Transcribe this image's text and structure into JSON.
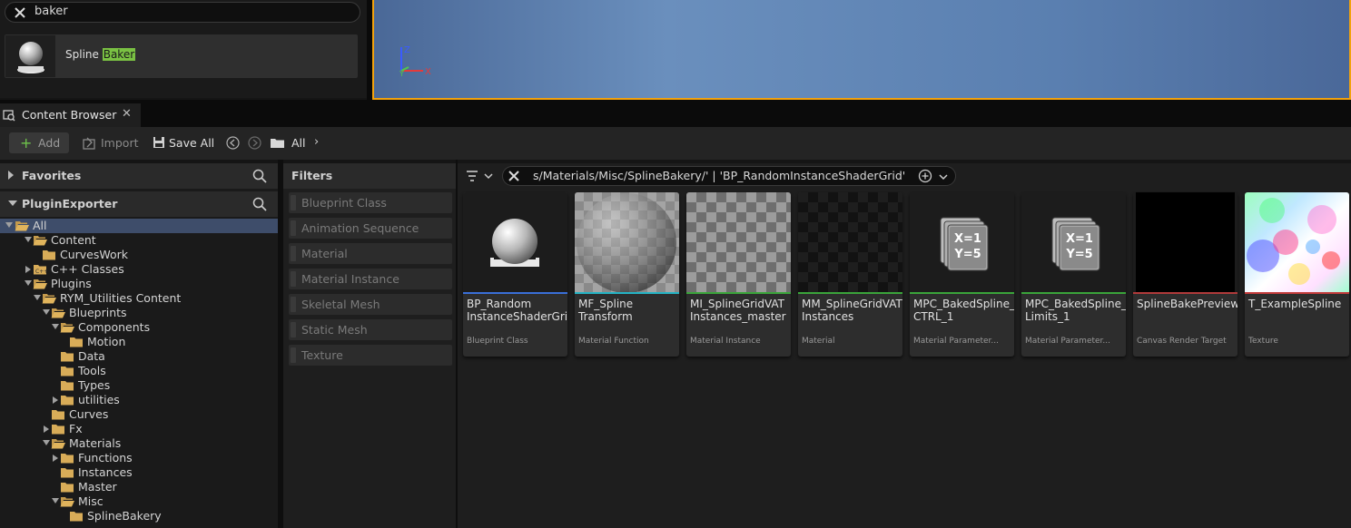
{
  "search": {
    "query": "baker"
  },
  "search_result": {
    "label_prefix": "Spline ",
    "label_highlight": "Baker"
  },
  "viewport": {
    "axis_z": "Z",
    "axis_x": "X",
    "axis_y": "Y"
  },
  "tab": {
    "label": "Content Browser",
    "close": "✕"
  },
  "toolbar": {
    "add_label": "Add",
    "import_label": "Import",
    "save_all_label": "Save All",
    "path_root": "All",
    "path_chevron": "›"
  },
  "left_panel": {
    "favorites_label": "Favorites",
    "plugin_exporter_label": "PluginExporter",
    "tree": [
      {
        "label": "All",
        "depth": 0,
        "expand": "open",
        "selected": true
      },
      {
        "label": "Content",
        "depth": 1,
        "expand": "open"
      },
      {
        "label": "CurvesWork",
        "depth": 2,
        "expand": "none"
      },
      {
        "label": "C++ Classes",
        "depth": 1,
        "expand": "closed",
        "cpp": true
      },
      {
        "label": "Plugins",
        "depth": 1,
        "expand": "open"
      },
      {
        "label": "RYM_Utilities Content",
        "depth": 2,
        "expand": "open"
      },
      {
        "label": "Blueprints",
        "depth": 3,
        "expand": "open"
      },
      {
        "label": "Components",
        "depth": 4,
        "expand": "open"
      },
      {
        "label": "Motion",
        "depth": 5,
        "expand": "none"
      },
      {
        "label": "Data",
        "depth": 4,
        "expand": "none"
      },
      {
        "label": "Tools",
        "depth": 4,
        "expand": "none"
      },
      {
        "label": "Types",
        "depth": 4,
        "expand": "none"
      },
      {
        "label": "utilities",
        "depth": 4,
        "expand": "closed"
      },
      {
        "label": "Curves",
        "depth": 3,
        "expand": "none"
      },
      {
        "label": "Fx",
        "depth": 3,
        "expand": "closed"
      },
      {
        "label": "Materials",
        "depth": 3,
        "expand": "open"
      },
      {
        "label": "Functions",
        "depth": 4,
        "expand": "closed"
      },
      {
        "label": "Instances",
        "depth": 4,
        "expand": "none"
      },
      {
        "label": "Master",
        "depth": 4,
        "expand": "none"
      },
      {
        "label": "Misc",
        "depth": 4,
        "expand": "open"
      },
      {
        "label": "SplineBakery",
        "depth": 5,
        "expand": "none"
      }
    ]
  },
  "filters": {
    "title": "Filters",
    "items": [
      "Blueprint Class",
      "Animation Sequence",
      "Material",
      "Material Instance",
      "Skeletal Mesh",
      "Static Mesh",
      "Texture"
    ]
  },
  "asset_search": {
    "text": "s/Materials/Misc/SplineBakery/' | 'BP_RandomInstanceShaderGrid'"
  },
  "assets": [
    {
      "name": "BP_Random\nInstanceShaderGrid",
      "type": "Blueprint Class",
      "color": "#3a6fd8",
      "thumb": "sphere-on-base"
    },
    {
      "name": "MF_Spline\nTransform",
      "type": "Material Function",
      "color": "#24b3c4",
      "thumb": "sphere-checker"
    },
    {
      "name": "MI_SplineGridVAT\nInstances_master",
      "type": "Material Instance",
      "color": "#3aa43a",
      "thumb": "checker-plane"
    },
    {
      "name": "MM_SplineGridVAT\nInstances",
      "type": "Material",
      "color": "#3aa43a",
      "thumb": "dark-checker"
    },
    {
      "name": "MPC_BakedSpline_\nCTRL_1",
      "type": "Material Parameter...",
      "color": "#3aa43a",
      "thumb": "param-collection",
      "icon_text_1": "X=1",
      "icon_text_2": "Y=5"
    },
    {
      "name": "MPC_BakedSpline_\nLimits_1",
      "type": "Material Parameter...",
      "color": "#3aa43a",
      "thumb": "param-collection",
      "icon_text_1": "X=1",
      "icon_text_2": "Y=5"
    },
    {
      "name": "SplineBakePreview",
      "type": "Canvas Render Target",
      "color": "#b03a3a",
      "thumb": "black"
    },
    {
      "name": "T_ExampleSpline",
      "type": "Texture",
      "color": "#c23a3a",
      "thumb": "rainbow-noise"
    }
  ]
}
